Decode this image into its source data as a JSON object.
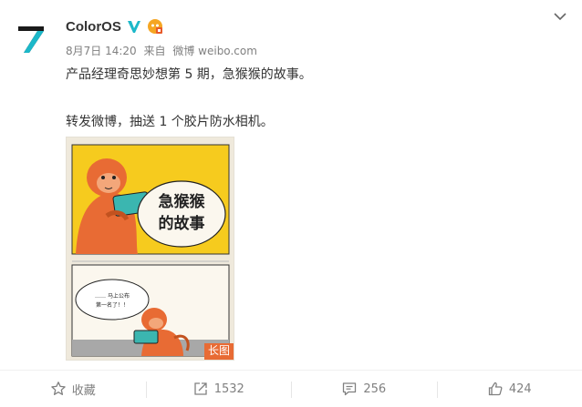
{
  "post": {
    "author": "ColorOS",
    "date": "8月7日 14:20",
    "source_prefix": "来自",
    "source": "微博 weibo.com",
    "text_line1": "产品经理奇思妙想第 5 期，急猴猴的故事。",
    "text_line2": "转发微博，抽送 1 个胶片防水相机。"
  },
  "image": {
    "panel1_caption_1": "急猴猴",
    "panel1_caption_2": "的故事",
    "panel2_bubble_1": "…… 马上公布",
    "panel2_bubble_2": "第一名了！！",
    "badge": "长图"
  },
  "actions": {
    "favorite_label": "收藏",
    "repost_count": "1532",
    "comment_count": "256",
    "like_count": "424"
  },
  "colors": {
    "brand_teal": "#1cb8c9",
    "verified_orange": "#f5a623",
    "badge_orange": "#e86b34",
    "panel_yellow": "#f6cb1e",
    "monkey_orange": "#e86b34"
  }
}
